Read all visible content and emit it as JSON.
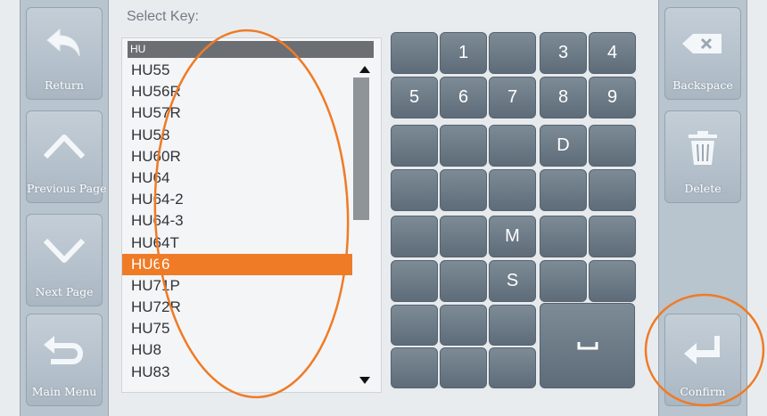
{
  "title": "Select Key:",
  "left_buttons": [
    {
      "label": "Return",
      "icon": "return-arrow-icon"
    },
    {
      "label": "Previous Page",
      "icon": "chevron-up-icon"
    },
    {
      "label": "Next Page",
      "icon": "chevron-down-icon"
    },
    {
      "label": "Main Menu",
      "icon": "main-menu-arrow-icon"
    }
  ],
  "right_buttons": [
    {
      "label": "Backspace",
      "icon": "backspace-icon"
    },
    {
      "label": "Delete",
      "icon": "trash-icon"
    },
    {
      "label": "Confirm",
      "icon": "enter-icon"
    }
  ],
  "list": {
    "header": "HU",
    "items": [
      "HU55",
      "HU56R",
      "HU57R",
      "HU58",
      "HU60R",
      "HU64",
      "HU64-2",
      "HU64-3",
      "HU64T",
      "HU66",
      "HU71P",
      "HU72R",
      "HU75",
      "HU8",
      "HU83"
    ],
    "selected_index": 9
  },
  "keypad": {
    "keys": [
      "",
      "1",
      "",
      "3",
      "4",
      "5",
      "6",
      "7",
      "8",
      "9",
      "",
      "",
      "",
      "D",
      "",
      "",
      "",
      "",
      "",
      "",
      "",
      "",
      "M",
      "",
      "",
      "",
      "",
      "S",
      "",
      "",
      "",
      "",
      "",
      "",
      "",
      ""
    ]
  },
  "colors": {
    "selected": "#ef7b26",
    "annotation": "#ef7b26"
  }
}
